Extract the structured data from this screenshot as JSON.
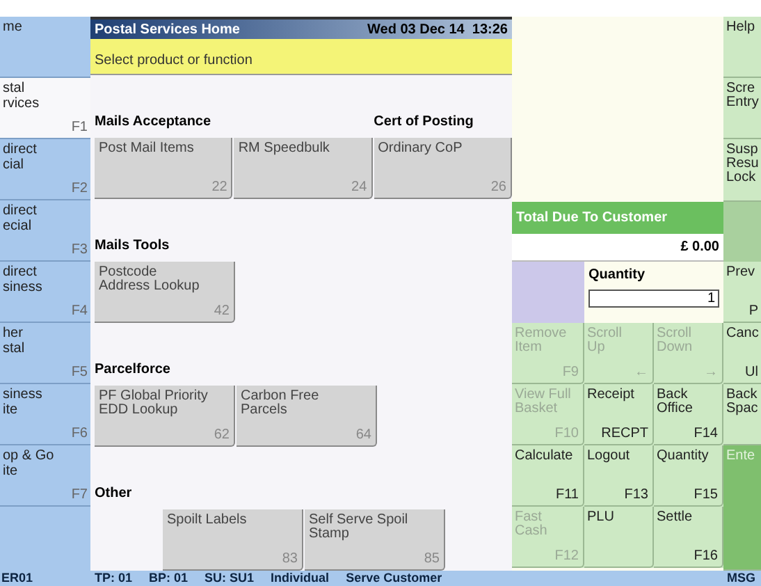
{
  "sidebar": {
    "items": [
      {
        "label": "me",
        "selected": false
      },
      {
        "label": "stal\nrvices",
        "key": "F1",
        "selected": true
      },
      {
        "label": "direct\ncial",
        "key": "F2",
        "selected": false
      },
      {
        "label": "direct\necial",
        "key": "F3",
        "selected": false
      },
      {
        "label": "direct\nsiness",
        "key": "F4",
        "selected": false
      },
      {
        "label": "her\nstal",
        "key": "F5",
        "selected": false
      },
      {
        "label": "siness\nite",
        "key": "F6",
        "selected": false
      },
      {
        "label": "op & Go\nite",
        "key": "F7",
        "selected": false
      }
    ]
  },
  "header": {
    "title": "Postal Services Home",
    "datetime": "Wed 03 Dec 14  13:26"
  },
  "prompt": "Select product or function",
  "sections": [
    {
      "kind": "grid",
      "title": "Mails Acceptance",
      "buttons": [
        {
          "label": "Post Mail Items",
          "code": "22"
        },
        {
          "label": "RM Speedbulk",
          "code": "24"
        },
        {
          "label": "Ordinary CoP",
          "code": "26",
          "heading": "Cert of Posting"
        }
      ]
    },
    {
      "kind": "grid",
      "title": "Mails Tools",
      "buttons": [
        {
          "label": "Postcode Address Lookup",
          "code": "42"
        }
      ]
    },
    {
      "kind": "grid",
      "title": "Parcelforce",
      "buttons": [
        {
          "label": "PF Global Priority EDD Lookup",
          "code": "62"
        },
        {
          "label": "Carbon Free Parcels",
          "code": "64"
        }
      ]
    },
    {
      "kind": "indented",
      "title": "Other",
      "buttons": [
        {
          "label": "Spoilt Labels",
          "code": "83"
        },
        {
          "label": "Self Serve Spoil Stamp",
          "code": "85"
        }
      ]
    }
  ],
  "total": {
    "label": "Total Due To Customer",
    "amount": "£ 0.00"
  },
  "quantity": {
    "label": "Quantity",
    "value": "1"
  },
  "keypad": [
    {
      "label": "Remove\nItem",
      "key": "F9",
      "disabled": true
    },
    {
      "label": "Scroll\nUp",
      "key": "←",
      "disabled": true
    },
    {
      "label": "Scroll\nDown",
      "key": "→",
      "disabled": true
    },
    {
      "label": "View Full\nBasket",
      "key": "F10",
      "disabled": true
    },
    {
      "label": "Receipt",
      "key": "RECPT",
      "disabled": false
    },
    {
      "label": "Back\nOffice",
      "key": "F14",
      "disabled": false
    },
    {
      "label": "Calculate",
      "key": "F11",
      "disabled": false
    },
    {
      "label": "Logout",
      "key": "F13",
      "disabled": false
    },
    {
      "label": "Quantity",
      "key": "F15",
      "disabled": false
    },
    {
      "label": "Fast\nCash",
      "key": "F12",
      "disabled": true
    },
    {
      "label": "PLU",
      "disabled": false
    },
    {
      "label": "Settle",
      "key": "F16",
      "disabled": false
    }
  ],
  "side_keys": [
    {
      "kind": "key",
      "label": "Help",
      "disabled": false
    },
    {
      "kind": "key",
      "label": "Scre\nEntry",
      "disabled": false
    },
    {
      "kind": "key",
      "label": "Susp\nResu\nLock",
      "disabled": false
    },
    {
      "kind": "blank"
    },
    {
      "kind": "key",
      "label": "Prev",
      "key": "P",
      "disabled": false
    },
    {
      "kind": "key",
      "label": "Canc",
      "key": "Ul",
      "disabled": false
    },
    {
      "kind": "key",
      "label": "Back\nSpac",
      "disabled": false
    },
    {
      "kind": "enter",
      "label": "Ente",
      "disabled": true
    }
  ],
  "status_bar": {
    "left": "ER01",
    "items": [
      "TP: 01",
      "BP: 01",
      "SU: SU1",
      "Individual",
      "Serve Customer"
    ],
    "right": "MSG"
  }
}
